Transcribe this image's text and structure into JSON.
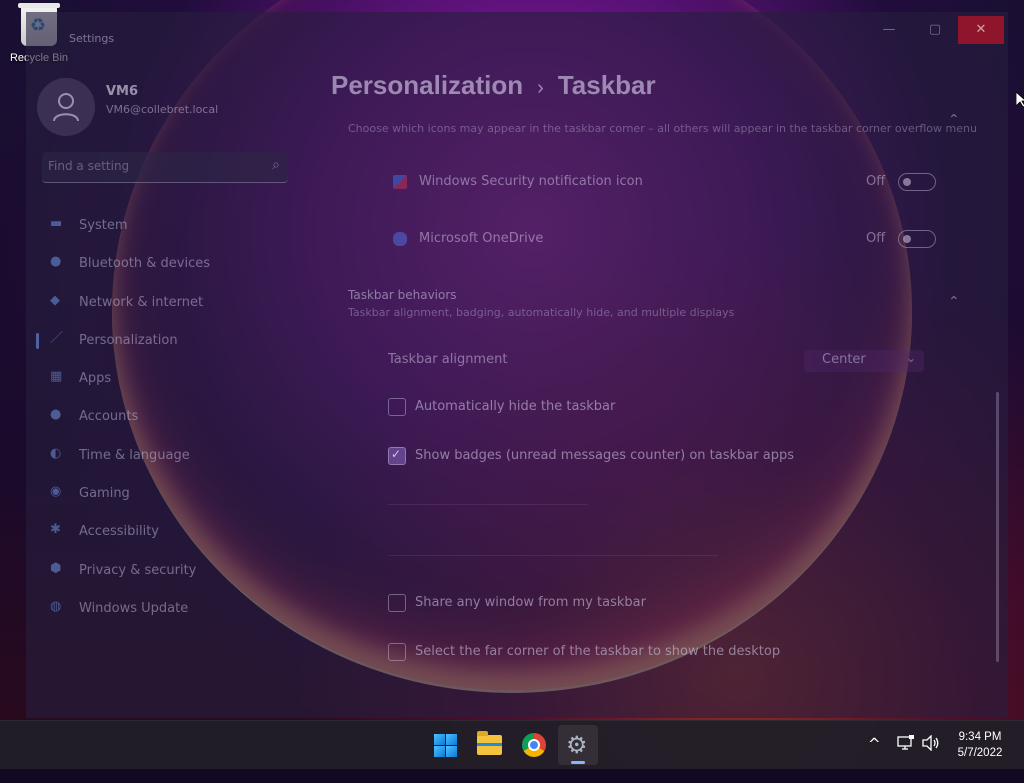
{
  "desktop": {
    "recycle_bin_label": "Recycle Bin"
  },
  "window": {
    "title": "Settings",
    "controls": {
      "minimize": "—",
      "maximize": "▢",
      "close": "✕"
    }
  },
  "user": {
    "name": "VM6",
    "email": "VM6@collebret.local"
  },
  "search": {
    "placeholder": "Find a setting"
  },
  "sidebar": {
    "items": [
      {
        "label": "System",
        "icon": "monitor-icon"
      },
      {
        "label": "Bluetooth & devices",
        "icon": "bluetooth-icon"
      },
      {
        "label": "Network & internet",
        "icon": "wifi-icon"
      },
      {
        "label": "Personalization",
        "icon": "brush-icon",
        "active": true
      },
      {
        "label": "Apps",
        "icon": "apps-icon"
      },
      {
        "label": "Accounts",
        "icon": "person-icon"
      },
      {
        "label": "Time & language",
        "icon": "globe-clock-icon"
      },
      {
        "label": "Gaming",
        "icon": "controller-icon"
      },
      {
        "label": "Accessibility",
        "icon": "accessibility-icon"
      },
      {
        "label": "Privacy & security",
        "icon": "shield-icon"
      },
      {
        "label": "Windows Update",
        "icon": "update-icon"
      }
    ]
  },
  "breadcrumb": {
    "parent": "Personalization",
    "separator": "›",
    "current": "Taskbar"
  },
  "corner_overflow": {
    "description": "Choose which icons may appear in the taskbar corner – all others will appear in the taskbar corner overflow menu",
    "items": [
      {
        "label": "Windows Security notification icon",
        "state": "Off"
      },
      {
        "label": "Microsoft OneDrive",
        "state": "Off"
      }
    ]
  },
  "behaviors": {
    "title": "Taskbar behaviors",
    "subtitle": "Taskbar alignment, badging, automatically hide, and multiple displays",
    "alignment": {
      "label": "Taskbar alignment",
      "value": "Center"
    },
    "checkboxes": [
      {
        "label": "Automatically hide the taskbar",
        "checked": false
      },
      {
        "label": "Show badges (unread messages counter) on taskbar apps",
        "checked": true
      },
      {
        "label": "Share any window from my taskbar",
        "checked": false
      },
      {
        "label": "Select the far corner of the taskbar to show the desktop",
        "checked": false
      }
    ]
  },
  "taskbar": {
    "apps": [
      {
        "name": "start"
      },
      {
        "name": "file-explorer"
      },
      {
        "name": "chrome"
      },
      {
        "name": "settings",
        "active": true
      }
    ],
    "tray": {
      "chevron": "^"
    },
    "clock": {
      "time": "9:34 PM",
      "date": "5/7/2022"
    }
  },
  "colors": {
    "accent": "#8ab4f8",
    "close_button": "#c42b1c"
  }
}
